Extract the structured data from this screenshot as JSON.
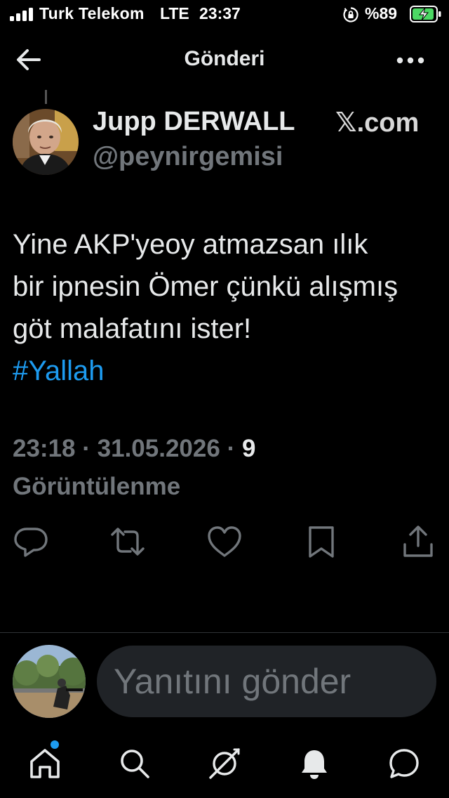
{
  "status_bar": {
    "carrier": "Turk Telekom",
    "network": "LTE",
    "time": "23:37",
    "battery_percent": "%89",
    "icons": [
      "signal-icon",
      "orientation-lock-icon",
      "battery-charging-icon"
    ]
  },
  "header": {
    "title": "Gönderi",
    "back_icon": "arrow-left-icon",
    "more_icon": "more-horizontal-icon"
  },
  "tweet": {
    "author_name": "Jupp DERWALL",
    "author_handle": "@peynirgemisi",
    "watermark": "𝕏.com",
    "text": "Yine AKP'yeoy  atmazsan ılık\nbir ipnesin Ömer çünkü alışmış\ngöt malafatını ister!",
    "hashtag": "#Yallah",
    "time": "23:18",
    "date": "31.05.2026",
    "views_count": "9",
    "views_label": "Görüntülenme"
  },
  "actions": [
    {
      "name": "reply",
      "icon": "comment-icon"
    },
    {
      "name": "retweet",
      "icon": "retweet-icon"
    },
    {
      "name": "like",
      "icon": "heart-icon"
    },
    {
      "name": "bookmark",
      "icon": "bookmark-icon"
    },
    {
      "name": "share",
      "icon": "share-icon"
    }
  ],
  "reply_bar": {
    "placeholder": "Yanıtını gönder"
  },
  "bottom_nav": {
    "items": [
      "home-icon",
      "search-icon",
      "grok-icon",
      "notifications-icon",
      "messages-icon"
    ],
    "home_has_badge": true
  },
  "colors": {
    "background": "#000000",
    "text": "#e7e9ea",
    "muted": "#71767b",
    "accent": "#1d9bf0",
    "battery": "#4cd964"
  }
}
